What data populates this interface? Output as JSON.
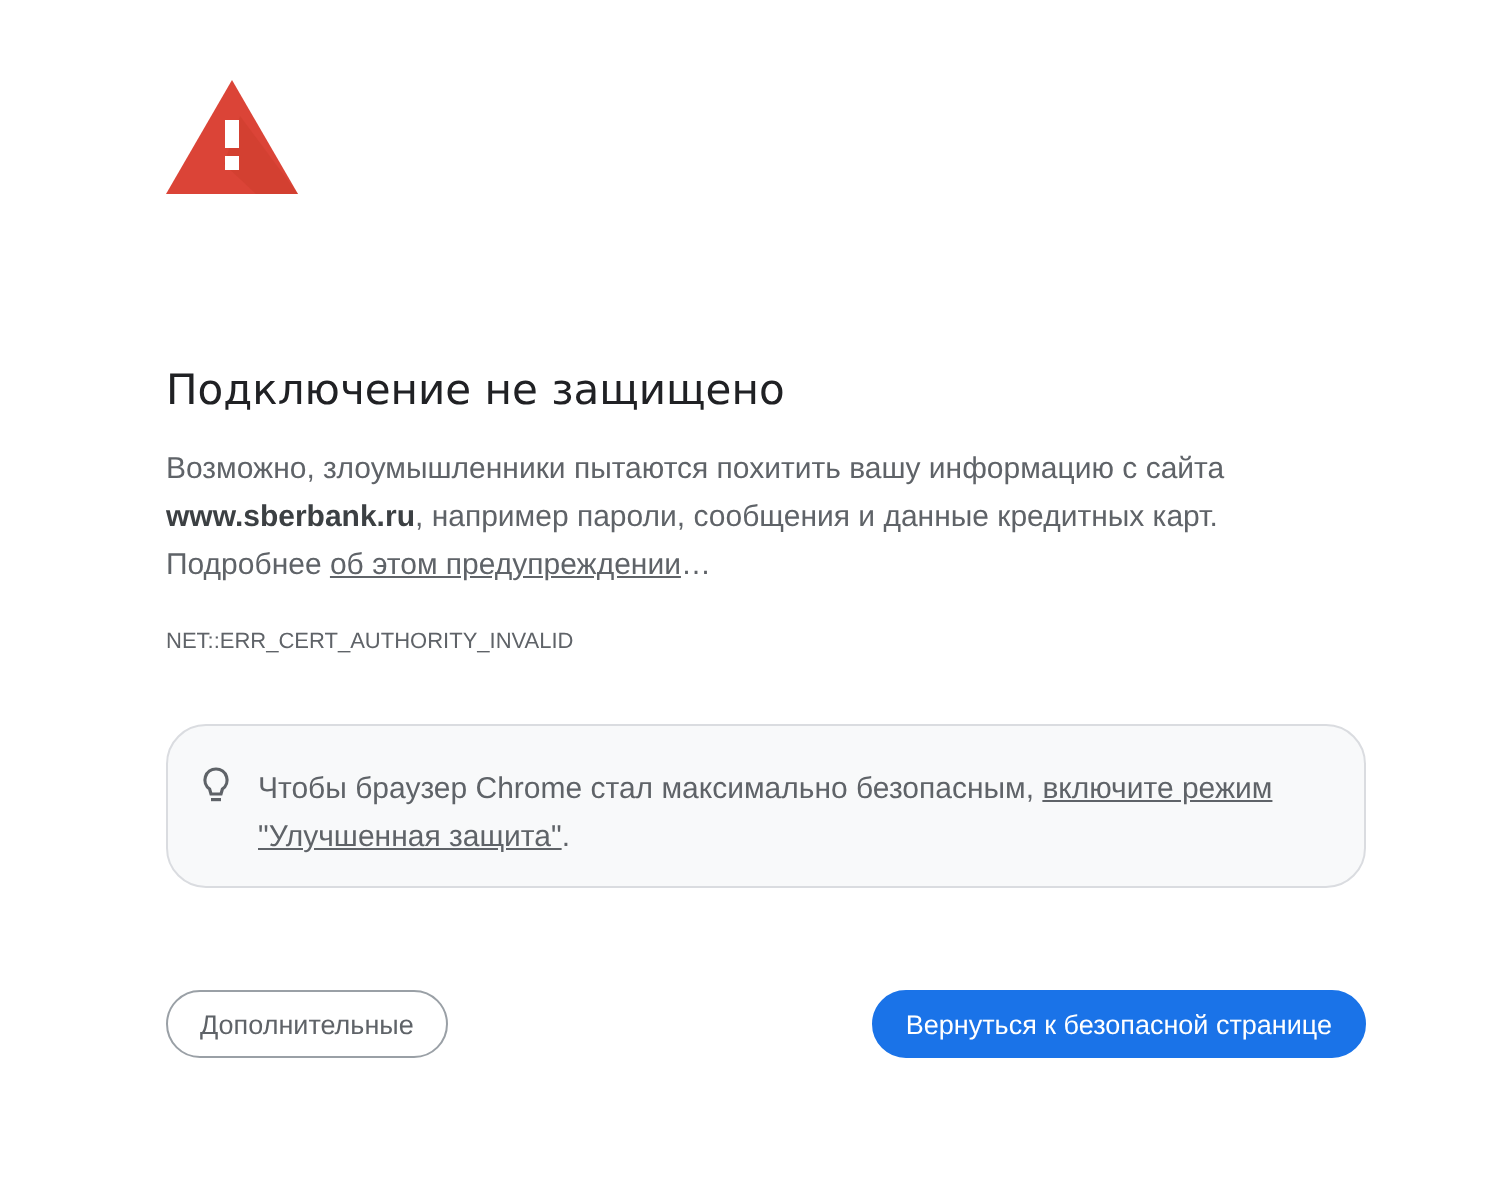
{
  "title": "Подключение не защищено",
  "description": "Возможно, злоумышленники пытаются похитить вашу информацию с сайта **www.sberbank.ru**, например пароли, сообщения и данные кредитных карт.",
  "learn_more": {
    "prefix": "Подробнее ",
    "link": "об этом предупреждении",
    "suffix": "…"
  },
  "error_code": "NET::ERR_CERT_AUTHORITY_INVALID",
  "tip": {
    "text": "Чтобы браузер Chrome стал максимально безопасным, ",
    "link_lines": [
      "включите режим",
      "\"Улучшенная защита\""
    ],
    "suffix": "."
  },
  "buttons": [
    {
      "label": "Дополнительные",
      "kind": "secondary"
    },
    {
      "label": "Вернуться к безопасной странице",
      "kind": "primary"
    }
  ]
}
